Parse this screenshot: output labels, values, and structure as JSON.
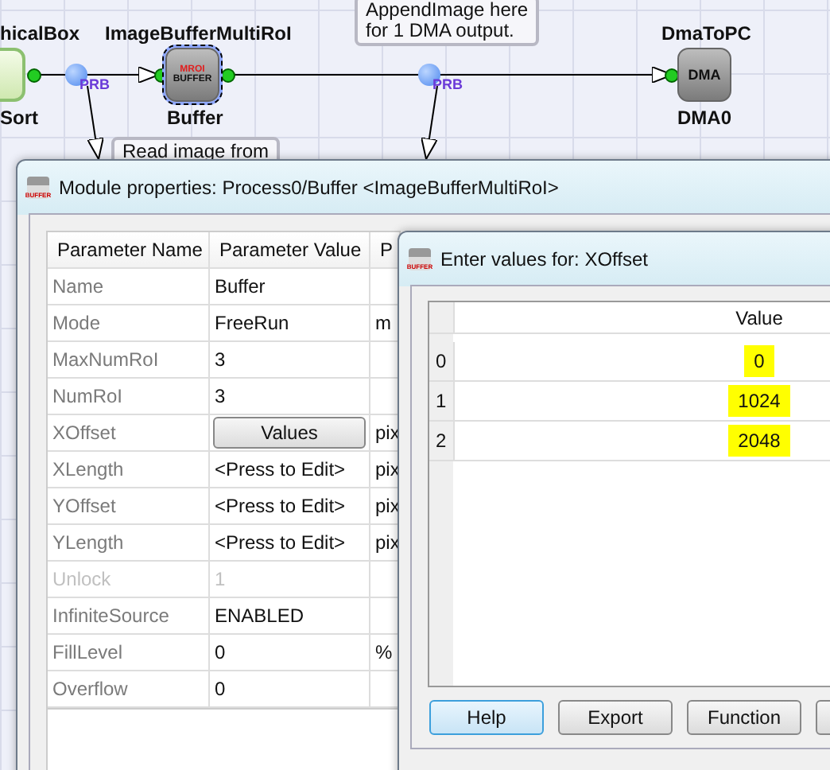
{
  "diagram": {
    "nodes": [
      {
        "kind": "partial",
        "type_label": "hicalBox",
        "name": "Sort"
      },
      {
        "kind": "buffer",
        "type_label": "ImageBufferMultiRoI",
        "name": "Buffer",
        "selected": true,
        "icon_text": [
          "MROI",
          "BUFFER"
        ]
      },
      {
        "kind": "dma",
        "type_label": "DmaToPC",
        "name": "DMA0",
        "selected": false,
        "icon_text": [
          "DMA"
        ]
      }
    ],
    "probes": [
      "PRB",
      "PRB"
    ],
    "notes": [
      {
        "lines": [
          "AppendImage here",
          "for 1 DMA output."
        ]
      },
      {
        "lines": [
          "Read image from"
        ]
      }
    ]
  },
  "module_window": {
    "title": "Module properties: Process0/Buffer <ImageBufferMultiRoI>",
    "icon_text": "BUFFER",
    "columns": [
      "Parameter Name",
      "Parameter Value",
      "P"
    ],
    "rows": [
      {
        "name": "Name",
        "value": "Buffer",
        "kind": "text",
        "disabled": false
      },
      {
        "name": "Mode",
        "value": "FreeRun",
        "unit": "m",
        "kind": "text",
        "disabled": false
      },
      {
        "name": "MaxNumRoI",
        "value": "3",
        "kind": "text",
        "disabled": false
      },
      {
        "name": "NumRoI",
        "value": "3",
        "kind": "text",
        "disabled": false
      },
      {
        "name": "XOffset",
        "value": "Values",
        "unit": "pix",
        "kind": "button",
        "disabled": false
      },
      {
        "name": "XLength",
        "value": "<Press to Edit>",
        "unit": "pix",
        "kind": "text",
        "disabled": false
      },
      {
        "name": "YOffset",
        "value": "<Press to Edit>",
        "unit": "pix",
        "kind": "text",
        "disabled": false
      },
      {
        "name": "YLength",
        "value": "<Press to Edit>",
        "unit": "pix",
        "kind": "text",
        "disabled": false
      },
      {
        "name": "Unlock",
        "value": "1",
        "kind": "text",
        "disabled": true
      },
      {
        "name": "InfiniteSource",
        "value": "ENABLED",
        "kind": "text",
        "disabled": false
      },
      {
        "name": "FillLevel",
        "value": "0",
        "unit": "%",
        "kind": "text",
        "disabled": false
      },
      {
        "name": "Overflow",
        "value": "0",
        "kind": "text",
        "disabled": false
      }
    ]
  },
  "dialog": {
    "title": "Enter values for: XOffset",
    "icon_text": "BUFFER",
    "column": "Value",
    "rows": [
      {
        "index": "0",
        "value": "0",
        "highlighted": true
      },
      {
        "index": "1",
        "value": "1024",
        "highlighted": true
      },
      {
        "index": "2",
        "value": "2048",
        "highlighted": true
      }
    ],
    "buttons": [
      {
        "label": "Help",
        "focused": true
      },
      {
        "label": "Export",
        "focused": false
      },
      {
        "label": "Function",
        "focused": false
      }
    ]
  }
}
